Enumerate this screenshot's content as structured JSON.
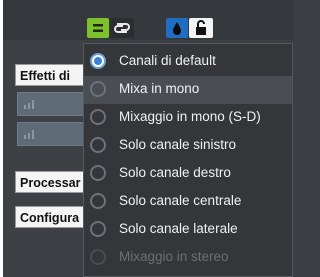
{
  "toolbar": {
    "buttons": [
      {
        "icon": "equals-icon",
        "color": "#7cc12b"
      },
      {
        "icon": "link-icon",
        "color": "#2b2d31"
      },
      {
        "icon": "drop-icon",
        "color": "#1f6ec4"
      },
      {
        "icon": "lock-icon",
        "color": "#f3f3f3"
      }
    ]
  },
  "sidebar": {
    "effects_label": "Effetti di",
    "process_label": "Processar",
    "config_label": "Configura"
  },
  "menu": {
    "items": [
      {
        "label": "Canali di default",
        "selected": true,
        "disabled": false
      },
      {
        "label": "Mixa in mono",
        "selected": false,
        "disabled": false,
        "hover": true
      },
      {
        "label": "Mixaggio in mono (S-D)",
        "selected": false,
        "disabled": false
      },
      {
        "label": "Solo canale sinistro",
        "selected": false,
        "disabled": false
      },
      {
        "label": "Solo canale destro",
        "selected": false,
        "disabled": false
      },
      {
        "label": "Solo canale centrale",
        "selected": false,
        "disabled": false
      },
      {
        "label": "Solo canale laterale",
        "selected": false,
        "disabled": false
      },
      {
        "label": "Mixaggio in stereo",
        "selected": false,
        "disabled": true
      }
    ]
  },
  "colors": {
    "accent": "#3c83d5",
    "hover": "#4a4e54",
    "disabled_text": "#6b6e73"
  }
}
